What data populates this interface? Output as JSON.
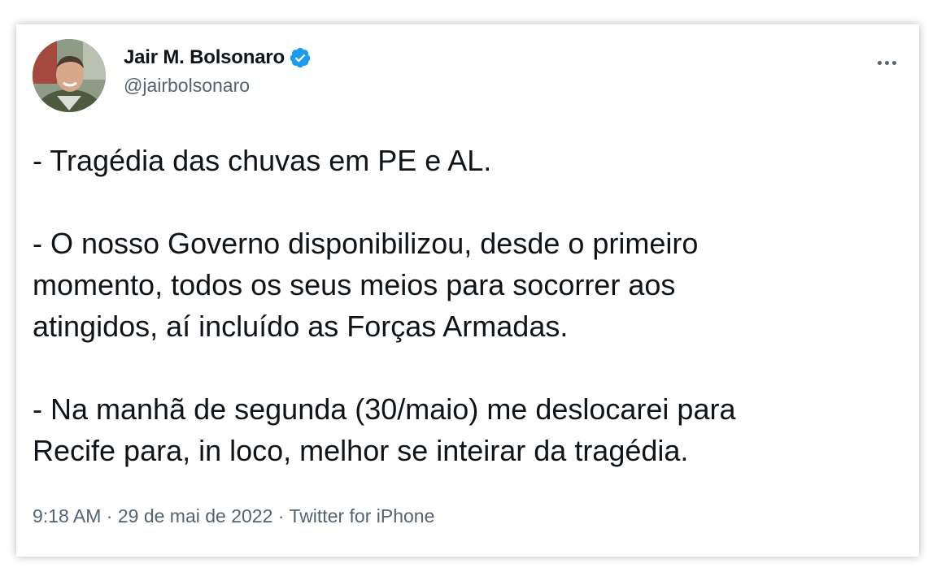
{
  "author": {
    "display_name": "Jair M. Bolsonaro",
    "handle": "@jairbolsonaro",
    "verified_icon": "verified-badge-icon",
    "avatar_icon": "avatar-photo"
  },
  "tweet": {
    "para1": "- Tragédia das chuvas em PE e AL.",
    "para2_line1": "- O nosso Governo disponibilizou, desde o primeiro",
    "para2_line2": "momento, todos os seus meios para socorrer aos",
    "para2_line3": "atingidos, aí incluído as Forças Armadas.",
    "para3_line1": "- Na manhã de segunda (30/maio) me deslocarei para",
    "para3_line2": "Recife para, in loco, melhor se inteirar da tragédia."
  },
  "meta": {
    "time": "9:18 AM",
    "separator": " · ",
    "date": "29 de mai de 2022",
    "source": "Twitter for iPhone"
  },
  "colors": {
    "text_primary": "#0f1419",
    "text_secondary": "#536471",
    "verified_blue": "#1d9bf0"
  }
}
